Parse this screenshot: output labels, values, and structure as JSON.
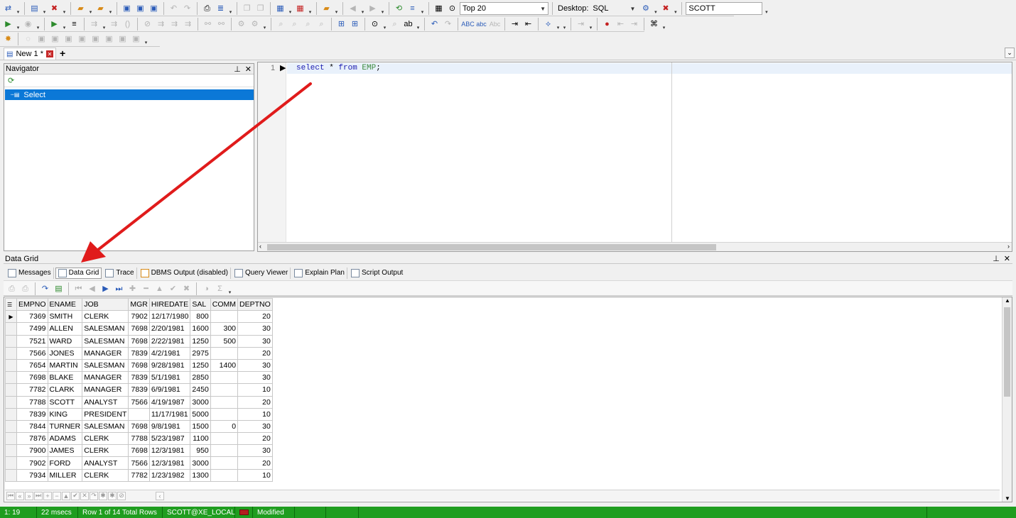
{
  "toolbar": {
    "top_n_value": "Top 20",
    "desktop_label": "Desktop:",
    "desktop_value": "SQL",
    "schema_value": "SCOTT"
  },
  "doc_tabs": [
    {
      "label": "New 1 *"
    }
  ],
  "navigator": {
    "title": "Navigator",
    "items": [
      {
        "label": "Select"
      }
    ]
  },
  "editor": {
    "line_number": "1",
    "code": {
      "kw1": "select",
      "star": " * ",
      "kw2": "from",
      "obj": " EMP",
      "end": ";"
    }
  },
  "results": {
    "panel_title": "Data Grid",
    "tabs": [
      {
        "label": "Messages"
      },
      {
        "label": "Data Grid"
      },
      {
        "label": "Trace"
      },
      {
        "label": "DBMS Output (disabled)"
      },
      {
        "label": "Query Viewer"
      },
      {
        "label": "Explain Plan"
      },
      {
        "label": "Script Output"
      }
    ],
    "columns": [
      "EMPNO",
      "ENAME",
      "JOB",
      "MGR",
      "HIREDATE",
      "SAL",
      "COMM",
      "DEPTNO"
    ],
    "rows": [
      [
        "7369",
        "SMITH",
        "CLERK",
        "7902",
        "12/17/1980",
        "800",
        "",
        "20"
      ],
      [
        "7499",
        "ALLEN",
        "SALESMAN",
        "7698",
        "2/20/1981",
        "1600",
        "300",
        "30"
      ],
      [
        "7521",
        "WARD",
        "SALESMAN",
        "7698",
        "2/22/1981",
        "1250",
        "500",
        "30"
      ],
      [
        "7566",
        "JONES",
        "MANAGER",
        "7839",
        "4/2/1981",
        "2975",
        "",
        "20"
      ],
      [
        "7654",
        "MARTIN",
        "SALESMAN",
        "7698",
        "9/28/1981",
        "1250",
        "1400",
        "30"
      ],
      [
        "7698",
        "BLAKE",
        "MANAGER",
        "7839",
        "5/1/1981",
        "2850",
        "",
        "30"
      ],
      [
        "7782",
        "CLARK",
        "MANAGER",
        "7839",
        "6/9/1981",
        "2450",
        "",
        "10"
      ],
      [
        "7788",
        "SCOTT",
        "ANALYST",
        "7566",
        "4/19/1987",
        "3000",
        "",
        "20"
      ],
      [
        "7839",
        "KING",
        "PRESIDENT",
        "",
        "11/17/1981",
        "5000",
        "",
        "10"
      ],
      [
        "7844",
        "TURNER",
        "SALESMAN",
        "7698",
        "9/8/1981",
        "1500",
        "0",
        "30"
      ],
      [
        "7876",
        "ADAMS",
        "CLERK",
        "7788",
        "5/23/1987",
        "1100",
        "",
        "20"
      ],
      [
        "7900",
        "JAMES",
        "CLERK",
        "7698",
        "12/3/1981",
        "950",
        "",
        "30"
      ],
      [
        "7902",
        "FORD",
        "ANALYST",
        "7566",
        "12/3/1981",
        "3000",
        "",
        "20"
      ],
      [
        "7934",
        "MILLER",
        "CLERK",
        "7782",
        "1/23/1982",
        "1300",
        "",
        "10"
      ]
    ]
  },
  "status": {
    "cursor": "1:  19",
    "elapsed": "22 msecs",
    "rows": "Row 1 of 14 Total Rows",
    "connection": "SCOTT@XE_LOCAL",
    "state": "Modified"
  },
  "colors": {
    "selection": "#0b78d7",
    "status_bar": "#1f9d1f",
    "annotation_arrow": "#e01b1b"
  }
}
